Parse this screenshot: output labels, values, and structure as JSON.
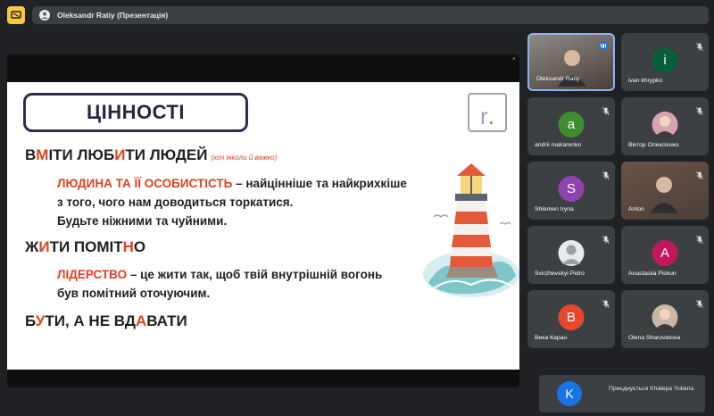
{
  "header": {
    "presenter_title": "Oleksandr Ratiy (Презентація)"
  },
  "slide": {
    "title": "ЦІННОСТІ",
    "logo_text": "r",
    "logo_dot": ".",
    "section1": {
      "heading_parts": [
        "В",
        "М",
        "ІТИ ЛЮБ",
        "И",
        "ТИ ЛЮДЕЙ"
      ],
      "note": "(хоч інколи й важко)",
      "lead": "ЛЮДИНА ТА ЇЇ ОСОБИСТІСТЬ",
      "line1_rest": " – найцінніше та найкрихкіше",
      "line2": "з того, чого нам доводиться торкатися.",
      "line3": "Будьте ніжними та чуйними."
    },
    "section2": {
      "heading_parts": [
        "Ж",
        "И",
        "ТИ ПОМІТ",
        "Н",
        "О"
      ],
      "lead": "ЛІДЕРСТВО",
      "line1_rest": " – це жити так, щоб твій внутрішній вогонь",
      "line2": "був помітний оточуючим."
    },
    "section3": {
      "heading_parts": [
        "Б",
        "У",
        "ТИ, А НЕ ВД",
        "А",
        "ВАТИ"
      ]
    }
  },
  "stage": {
    "close_glyph": "×"
  },
  "participants": [
    {
      "name": "Oleksandr Ratiy",
      "initial": "",
      "color": "#8d8a86",
      "type": "video",
      "speaking": true
    },
    {
      "name": "ivan khrypko",
      "initial": "i",
      "color": "#0b5e3b",
      "type": "avatar"
    },
    {
      "name": "andrii makarenko",
      "initial": "a",
      "color": "#3f8d2f",
      "type": "avatar"
    },
    {
      "name": "Віктор Олексієнко",
      "initial": "",
      "color": "#d9a2b0",
      "type": "photo"
    },
    {
      "name": "Shlemen Iryna",
      "initial": "S",
      "color": "#8e44ad",
      "type": "avatar"
    },
    {
      "name": "Anton",
      "initial": "",
      "color": "#6b5248",
      "type": "video"
    },
    {
      "name": "Svirzhevskyi Petro",
      "initial": "",
      "color": "#e8eaed",
      "type": "default"
    },
    {
      "name": "Anastasiia Piskun",
      "initial": "A",
      "color": "#c2185b",
      "type": "avatar"
    },
    {
      "name": "Вика Каран",
      "initial": "B",
      "color": "#e8472b",
      "type": "avatar"
    },
    {
      "name": "Olena Sharovatova",
      "initial": "",
      "color": "#c9b8a8",
      "type": "photo"
    }
  ],
  "join_notice": {
    "initial": "K",
    "text": "Приєднується Khalepa Yuliana"
  },
  "colors": {
    "accent_red": "#e0411f",
    "presenting_yellow": "#f9c641",
    "speaking_blue": "#1a73e8"
  }
}
